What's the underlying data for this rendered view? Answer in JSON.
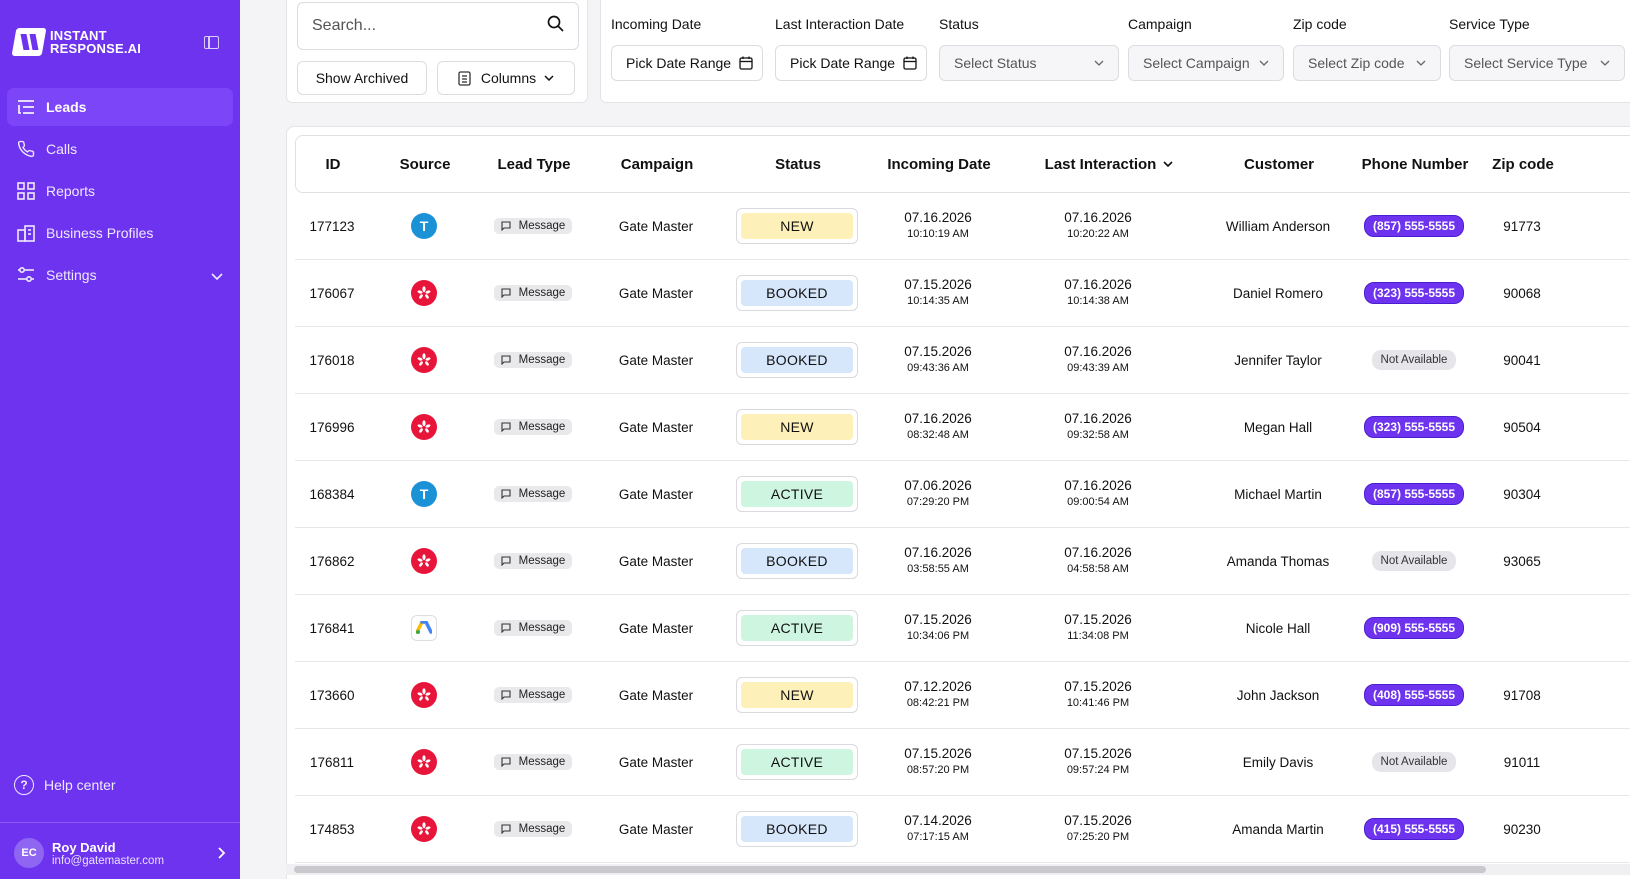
{
  "app": {
    "logo_line1": "INSTANT",
    "logo_line2": "RESPONSE.AI"
  },
  "sidebar": {
    "items": [
      {
        "label": "Leads",
        "icon": "list-icon",
        "active": true
      },
      {
        "label": "Calls",
        "icon": "phone-icon"
      },
      {
        "label": "Reports",
        "icon": "grid-icon"
      },
      {
        "label": "Business Profiles",
        "icon": "building-icon"
      },
      {
        "label": "Settings",
        "icon": "sliders-icon"
      }
    ],
    "help": "Help center",
    "user": {
      "initials": "EC",
      "name": "Roy David",
      "email": "info@gatemaster.com"
    }
  },
  "toolbar": {
    "search_placeholder": "Search...",
    "show_archived": "Show Archived",
    "columns": "Columns"
  },
  "filters": {
    "incoming_label": "Incoming Date",
    "incoming_value": "Pick Date Range",
    "last_label": "Last Interaction Date",
    "last_value": "Pick Date Range",
    "status_label": "Status",
    "status_value": "Select Status",
    "campaign_label": "Campaign",
    "campaign_value": "Select Campaign",
    "zip_label": "Zip code",
    "zip_value": "Select Zip code",
    "service_label": "Service Type",
    "service_value": "Select Service Type"
  },
  "table": {
    "headers": {
      "id": "ID",
      "source": "Source",
      "lead_type": "Lead Type",
      "campaign": "Campaign",
      "status": "Status",
      "incoming": "Incoming Date",
      "last": "Last Interaction",
      "customer": "Customer",
      "phone": "Phone Number",
      "zip": "Zip code"
    },
    "rows": [
      {
        "id": "177123",
        "source": "T",
        "lead_type": "Message",
        "campaign": "Gate Master",
        "status": "NEW",
        "in_date": "07.16.2026",
        "in_time": "10:10:19 AM",
        "last_date": "07.16.2026",
        "last_time": "10:20:22 AM",
        "customer": "William Anderson",
        "phone": "(857) 555-5555",
        "zip": "91773"
      },
      {
        "id": "176067",
        "source": "yelp",
        "lead_type": "Message",
        "campaign": "Gate Master",
        "status": "BOOKED",
        "in_date": "07.15.2026",
        "in_time": "10:14:35 AM",
        "last_date": "07.16.2026",
        "last_time": "10:14:38 AM",
        "customer": "Daniel Romero",
        "phone": "(323) 555-5555",
        "zip": "90068"
      },
      {
        "id": "176018",
        "source": "yelp",
        "lead_type": "Message",
        "campaign": "Gate Master",
        "status": "BOOKED",
        "in_date": "07.15.2026",
        "in_time": "09:43:36 AM",
        "last_date": "07.16.2026",
        "last_time": "09:43:39 AM",
        "customer": "Jennifer Taylor",
        "phone": "Not Available",
        "zip": "90041"
      },
      {
        "id": "176996",
        "source": "yelp",
        "lead_type": "Message",
        "campaign": "Gate Master",
        "status": "NEW",
        "in_date": "07.16.2026",
        "in_time": "08:32:48 AM",
        "last_date": "07.16.2026",
        "last_time": "09:32:58 AM",
        "customer": "Megan Hall",
        "phone": "(323) 555-5555",
        "zip": "90504"
      },
      {
        "id": "168384",
        "source": "T",
        "lead_type": "Message",
        "campaign": "Gate Master",
        "status": "ACTIVE",
        "in_date": "07.06.2026",
        "in_time": "07:29:20 PM",
        "last_date": "07.16.2026",
        "last_time": "09:00:54 AM",
        "customer": "Michael Martin",
        "phone": "(857) 555-5555",
        "zip": "90304"
      },
      {
        "id": "176862",
        "source": "yelp",
        "lead_type": "Message",
        "campaign": "Gate Master",
        "status": "BOOKED",
        "in_date": "07.16.2026",
        "in_time": "03:58:55 AM",
        "last_date": "07.16.2026",
        "last_time": "04:58:58 AM",
        "customer": "Amanda Thomas",
        "phone": "Not Available",
        "zip": "93065"
      },
      {
        "id": "176841",
        "source": "ads",
        "lead_type": "Message",
        "campaign": "Gate Master",
        "status": "ACTIVE",
        "in_date": "07.15.2026",
        "in_time": "10:34:06 PM",
        "last_date": "07.15.2026",
        "last_time": "11:34:08 PM",
        "customer": "Nicole Hall",
        "phone": "(909) 555-5555",
        "zip": ""
      },
      {
        "id": "173660",
        "source": "yelp",
        "lead_type": "Message",
        "campaign": "Gate Master",
        "status": "NEW",
        "in_date": "07.12.2026",
        "in_time": "08:42:21 PM",
        "last_date": "07.15.2026",
        "last_time": "10:41:46 PM",
        "customer": "John Jackson",
        "phone": "(408) 555-5555",
        "zip": "91708"
      },
      {
        "id": "176811",
        "source": "yelp",
        "lead_type": "Message",
        "campaign": "Gate Master",
        "status": "ACTIVE",
        "in_date": "07.15.2026",
        "in_time": "08:57:20 PM",
        "last_date": "07.15.2026",
        "last_time": "09:57:24 PM",
        "customer": "Emily Davis",
        "phone": "Not Available",
        "zip": "91011"
      },
      {
        "id": "174853",
        "source": "yelp",
        "lead_type": "Message",
        "campaign": "Gate Master",
        "status": "BOOKED",
        "in_date": "07.14.2026",
        "in_time": "07:17:15 AM",
        "last_date": "07.15.2026",
        "last_time": "07:25:20 PM",
        "customer": "Amanda Martin",
        "phone": "(415) 555-5555",
        "zip": "90230"
      }
    ]
  },
  "colors": {
    "brand": "#6e33ef",
    "status_new": "#fdf0b8",
    "status_booked": "#d6e6fb",
    "status_active": "#cdf5df"
  }
}
